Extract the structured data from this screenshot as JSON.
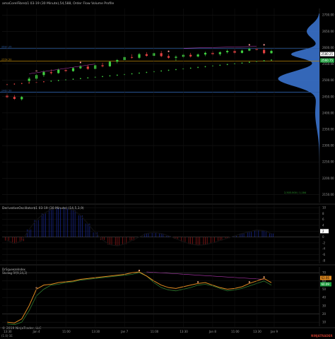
{
  "panes": {
    "price": {
      "title": "amaCorelFibre$1 03-19 (30 Minute),54,588, Order Flow Volume Profile",
      "y_ticks": [
        "2700.00",
        "2650.00",
        "2600.00",
        "2550.00",
        "2500.00",
        "2450.00",
        "2400.00",
        "2350.00",
        "2300.00",
        "2250.00",
        "2200.00",
        "2150.00"
      ],
      "y_tick_values": [
        2700,
        2650,
        2600,
        2550,
        2500,
        2450,
        2400,
        2350,
        2300,
        2250,
        2200,
        2150
      ],
      "y_range": [
        2125,
        2720
      ],
      "level_lines": [
        {
          "label": "2597.25",
          "value": 2597.25,
          "color": "#2e5fa8"
        },
        {
          "label": "2558.50",
          "value": 2558.5,
          "color": "#b8860b"
        },
        {
          "label": "2463.50",
          "value": 2463.5,
          "color": "#2e5fa8"
        }
      ],
      "last_price_tag": "2580.25",
      "second_price_tag": "2560.75",
      "poc_label": "2,503.500 / 1,184",
      "candles": [
        [
          2453,
          2460,
          2445,
          2448
        ],
        [
          2449,
          2455,
          2440,
          2443
        ],
        [
          2442,
          2452,
          2438,
          2449
        ],
        [
          2498,
          2510,
          2494,
          2505
        ],
        [
          2505,
          2520,
          2500,
          2516
        ],
        [
          2516,
          2530,
          2510,
          2525
        ],
        [
          2525,
          2533,
          2518,
          2522
        ],
        [
          2522,
          2536,
          2520,
          2532
        ],
        [
          2532,
          2538,
          2524,
          2528
        ],
        [
          2528,
          2540,
          2526,
          2537
        ],
        [
          2537,
          2546,
          2534,
          2542
        ],
        [
          2542,
          2548,
          2532,
          2535
        ],
        [
          2535,
          2550,
          2533,
          2546
        ],
        [
          2546,
          2554,
          2540,
          2543
        ],
        [
          2543,
          2560,
          2541,
          2557
        ],
        [
          2557,
          2565,
          2552,
          2562
        ],
        [
          2562,
          2575,
          2560,
          2571
        ],
        [
          2571,
          2580,
          2566,
          2569
        ],
        [
          2569,
          2584,
          2565,
          2580
        ],
        [
          2580,
          2586,
          2572,
          2575
        ],
        [
          2575,
          2586,
          2570,
          2583
        ],
        [
          2583,
          2590,
          2571,
          2574
        ],
        [
          2574,
          2580,
          2566,
          2569
        ],
        [
          2569,
          2576,
          2560,
          2572
        ],
        [
          2572,
          2582,
          2568,
          2578
        ],
        [
          2578,
          2584,
          2570,
          2573
        ],
        [
          2573,
          2582,
          2570,
          2579
        ],
        [
          2579,
          2588,
          2574,
          2584
        ],
        [
          2584,
          2590,
          2576,
          2580
        ],
        [
          2580,
          2589,
          2575,
          2586
        ],
        [
          2586,
          2594,
          2582,
          2590
        ],
        [
          2590,
          2596,
          2580,
          2584
        ],
        [
          2584,
          2594,
          2582,
          2591
        ],
        [
          2591,
          2600,
          2589,
          2596
        ],
        [
          2596,
          2602,
          2590,
          2593
        ],
        [
          2593,
          2600,
          2580,
          2583
        ],
        [
          2583,
          2594,
          2581,
          2590
        ]
      ],
      "dotted_trend": {
        "start": 2487,
        "end": 2562
      }
    },
    "osc": {
      "title": "DerivativeOscillator$1 03-19 (30 Minute) (14,5,3,9)",
      "y_ticks": [
        "10",
        "8",
        "6",
        "4",
        "2",
        "0",
        "-2",
        "-4",
        "-6",
        "-8"
      ],
      "y_tick_values": [
        10,
        8,
        6,
        4,
        2,
        0,
        -2,
        -4,
        -6,
        -8
      ],
      "y_range": [
        -9,
        10.5
      ],
      "last_value": "2",
      "values": [
        -1.2,
        -2.2,
        -1.4,
        2.6,
        5.8,
        8.0,
        9.4,
        10.0,
        10.0,
        9.2,
        7.4,
        4.6,
        1.6,
        -1.0,
        -2.6,
        -3.0,
        -2.4,
        -1.2,
        0.0,
        1.2,
        1.6,
        1.2,
        0.4,
        -0.6,
        -1.6,
        -2.4,
        -2.8,
        -2.6,
        -2.0,
        -1.2,
        -0.4,
        0.4,
        1.2,
        1.8,
        2.4,
        2.2,
        1.2
      ]
    },
    "stoch": {
      "title": "DrSqueezeIndex\nStodag Rf(9,14,3)",
      "y_ticks": [
        "70",
        "60",
        "50",
        "40",
        "30",
        "20",
        "10"
      ],
      "y_tick_values": [
        70,
        60,
        50,
        40,
        30,
        20,
        10
      ],
      "y_range": [
        5,
        77
      ],
      "tag1": "63.66",
      "tag2": "60.09",
      "k_values": [
        10,
        9,
        14,
        30,
        50,
        55,
        56,
        58,
        59,
        60,
        62,
        63,
        64,
        65,
        66,
        67,
        68,
        70,
        71,
        66,
        60,
        55,
        52,
        51,
        53,
        55,
        57,
        58,
        55,
        52,
        50,
        51,
        53,
        57,
        60,
        63,
        58
      ],
      "d_values": [
        8,
        7,
        10,
        24,
        42,
        50,
        55,
        56,
        58,
        59,
        61,
        62,
        63,
        64,
        65,
        66,
        67,
        68,
        70,
        66,
        58,
        52,
        49,
        48,
        50,
        52,
        55,
        56,
        54,
        51,
        48,
        49,
        51,
        54,
        57,
        60,
        55
      ]
    }
  },
  "x_axis": {
    "labels": [
      "13:30",
      "Jan 4",
      "11:00",
      "13:30",
      "Jan 7",
      "11:00",
      "13:30",
      "Jan 8",
      "11:00",
      "13:30",
      "Jan 9"
    ],
    "bar_index": [
      0,
      4,
      8,
      12,
      16,
      20,
      24,
      28,
      31,
      34,
      37
    ]
  },
  "watermark": "© 2019 NinjaTrader, LLC",
  "footer_left": "(1.0)·1E",
  "logo_text": "NINJATRADER",
  "colors": {
    "background": "#000000",
    "grid": "#1c1c1c",
    "up": "#40d040",
    "down": "#e04040",
    "profile": "#3d79d8",
    "osc_line": "#111111",
    "osc_pos": "#1a2a9c",
    "osc_neg": "#9c1a1a",
    "stoch_k": "#e08a20",
    "stoch_d": "#2f7a2f",
    "magenta": "#c03cc0"
  }
}
